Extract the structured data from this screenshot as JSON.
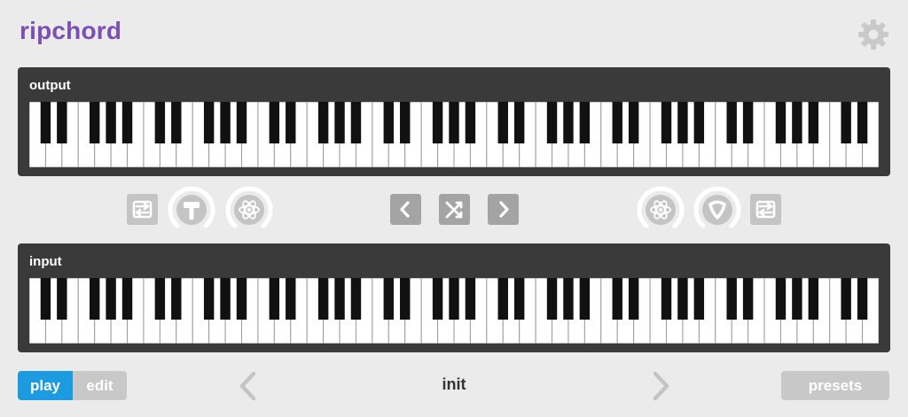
{
  "app": {
    "title": "ripchord"
  },
  "output_panel": {
    "label": "output"
  },
  "input_panel": {
    "label": "input"
  },
  "keyboard": {
    "white_key_count": 52
  },
  "footer": {
    "play_label": "play",
    "edit_label": "edit",
    "preset_name": "init",
    "presets_label": "presets"
  },
  "icons": {
    "settings": "gear-icon",
    "left_transpose": "swap-arrows-icon",
    "left_knob": "hammer-icon",
    "left_knob2": "atom-icon",
    "prev": "chevron-left-icon",
    "shuffle": "shuffle-icon",
    "next": "chevron-right-icon",
    "right_knob": "atom-icon",
    "right_knob2": "guitar-pick-icon",
    "right_transpose": "swap-arrows-icon",
    "preset_prev": "chevron-left-icon",
    "preset_next": "chevron-right-icon"
  },
  "colors": {
    "accent_purple": "#7b4fb5",
    "play_blue": "#1d9be0",
    "panel_bg": "#3a3a3a",
    "button_gray": "#c8c8c8"
  }
}
